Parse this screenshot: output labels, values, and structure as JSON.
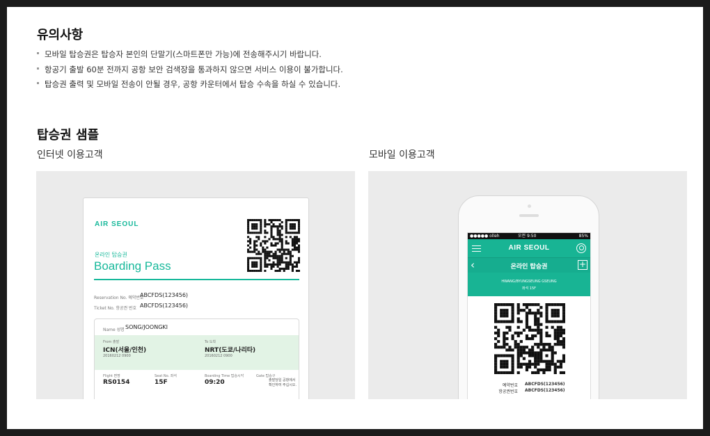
{
  "notice": {
    "title": "유의사항",
    "items": [
      "모바일 탑승권은 탑승자 본인의 단말기(스마트폰만 가능)에 전송해주시기 바랍니다.",
      "항공기 출발 60분 전까지 공항 보안 검색장을 통과하지 않으면 서비스 이용이 불가합니다.",
      "탑승권 출력 및 모바일 전송이 안될 경우, 공항 카운터에서 탑승 수속을 하실 수 있습니다."
    ]
  },
  "sample": {
    "title": "탑승권 샘플",
    "internet_label": "인터넷 이용고객",
    "mobile_label": "모바일 이용고객"
  },
  "ticket": {
    "brand": "AIR SEOUL",
    "subtitle": "온라인 탑승권",
    "title": "Boarding Pass",
    "reservation_label": "Reservation No. 예약번호",
    "reservation_value": "ABCFDS(123456)",
    "ticket_label": "Ticket No. 항공권 번호",
    "ticket_value": "ABCFDS(123456)",
    "name_label": "Name 성명",
    "name_value": "SONG/JOONGKI",
    "from_label": "From 출발",
    "from_value": "ICN(서울/인천)",
    "from_date": "20160212 0900",
    "to_label": "To 도착",
    "to_value": "NRT(도쿄/나리타)",
    "to_date": "20160212 0900",
    "flight_label": "Flight 편명",
    "flight_value": "RS0154",
    "seat_label": "Seat No. 좌석",
    "seat_value": "15F",
    "boarding_label": "Boarding Time 탑승시각",
    "boarding_value": "09:20",
    "gate_label": "Gate 탑승구",
    "gate_note": "출발당일 공항에서 확인하여 주십시오."
  },
  "phone": {
    "carrier": "●●●●● olleh",
    "time": "오전 9:50",
    "battery": "85%",
    "brand": "AIR SEOUL",
    "screen_title": "온라인 탑승권",
    "passenger": "HWANG/BYUNGSEUNG GSEUNG",
    "seat": "좌석 15F",
    "reservation_label": "예약번호",
    "reservation_value": "ABCFDS(123456)",
    "ticket_label": "항공권번호",
    "ticket_value": "ABCFDS(123456)"
  },
  "colors": {
    "brand_green": "#16b89a",
    "route_bg": "#e2f3e5",
    "panel_bg": "#ebebeb"
  },
  "icons": [
    "menu-icon",
    "profile-icon",
    "back-icon",
    "plus-icon",
    "qr-code"
  ]
}
